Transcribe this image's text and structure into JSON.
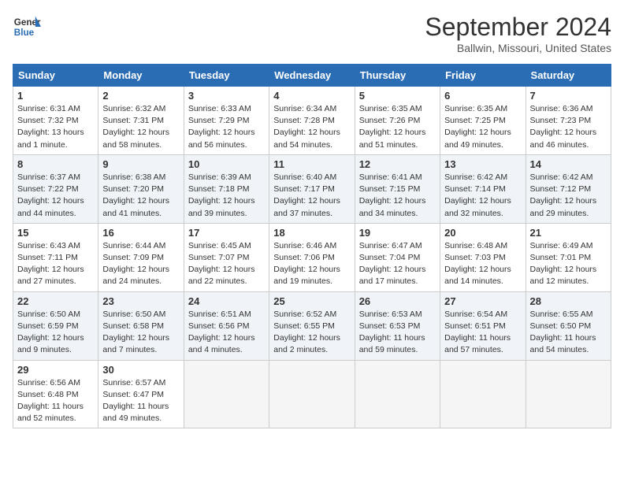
{
  "header": {
    "logo_line1": "General",
    "logo_line2": "Blue",
    "month_title": "September 2024",
    "location": "Ballwin, Missouri, United States"
  },
  "days_of_week": [
    "Sunday",
    "Monday",
    "Tuesday",
    "Wednesday",
    "Thursday",
    "Friday",
    "Saturday"
  ],
  "weeks": [
    [
      {
        "day": "1",
        "info": "Sunrise: 6:31 AM\nSunset: 7:32 PM\nDaylight: 13 hours\nand 1 minute."
      },
      {
        "day": "2",
        "info": "Sunrise: 6:32 AM\nSunset: 7:31 PM\nDaylight: 12 hours\nand 58 minutes."
      },
      {
        "day": "3",
        "info": "Sunrise: 6:33 AM\nSunset: 7:29 PM\nDaylight: 12 hours\nand 56 minutes."
      },
      {
        "day": "4",
        "info": "Sunrise: 6:34 AM\nSunset: 7:28 PM\nDaylight: 12 hours\nand 54 minutes."
      },
      {
        "day": "5",
        "info": "Sunrise: 6:35 AM\nSunset: 7:26 PM\nDaylight: 12 hours\nand 51 minutes."
      },
      {
        "day": "6",
        "info": "Sunrise: 6:35 AM\nSunset: 7:25 PM\nDaylight: 12 hours\nand 49 minutes."
      },
      {
        "day": "7",
        "info": "Sunrise: 6:36 AM\nSunset: 7:23 PM\nDaylight: 12 hours\nand 46 minutes."
      }
    ],
    [
      {
        "day": "8",
        "info": "Sunrise: 6:37 AM\nSunset: 7:22 PM\nDaylight: 12 hours\nand 44 minutes."
      },
      {
        "day": "9",
        "info": "Sunrise: 6:38 AM\nSunset: 7:20 PM\nDaylight: 12 hours\nand 41 minutes."
      },
      {
        "day": "10",
        "info": "Sunrise: 6:39 AM\nSunset: 7:18 PM\nDaylight: 12 hours\nand 39 minutes."
      },
      {
        "day": "11",
        "info": "Sunrise: 6:40 AM\nSunset: 7:17 PM\nDaylight: 12 hours\nand 37 minutes."
      },
      {
        "day": "12",
        "info": "Sunrise: 6:41 AM\nSunset: 7:15 PM\nDaylight: 12 hours\nand 34 minutes."
      },
      {
        "day": "13",
        "info": "Sunrise: 6:42 AM\nSunset: 7:14 PM\nDaylight: 12 hours\nand 32 minutes."
      },
      {
        "day": "14",
        "info": "Sunrise: 6:42 AM\nSunset: 7:12 PM\nDaylight: 12 hours\nand 29 minutes."
      }
    ],
    [
      {
        "day": "15",
        "info": "Sunrise: 6:43 AM\nSunset: 7:11 PM\nDaylight: 12 hours\nand 27 minutes."
      },
      {
        "day": "16",
        "info": "Sunrise: 6:44 AM\nSunset: 7:09 PM\nDaylight: 12 hours\nand 24 minutes."
      },
      {
        "day": "17",
        "info": "Sunrise: 6:45 AM\nSunset: 7:07 PM\nDaylight: 12 hours\nand 22 minutes."
      },
      {
        "day": "18",
        "info": "Sunrise: 6:46 AM\nSunset: 7:06 PM\nDaylight: 12 hours\nand 19 minutes."
      },
      {
        "day": "19",
        "info": "Sunrise: 6:47 AM\nSunset: 7:04 PM\nDaylight: 12 hours\nand 17 minutes."
      },
      {
        "day": "20",
        "info": "Sunrise: 6:48 AM\nSunset: 7:03 PM\nDaylight: 12 hours\nand 14 minutes."
      },
      {
        "day": "21",
        "info": "Sunrise: 6:49 AM\nSunset: 7:01 PM\nDaylight: 12 hours\nand 12 minutes."
      }
    ],
    [
      {
        "day": "22",
        "info": "Sunrise: 6:50 AM\nSunset: 6:59 PM\nDaylight: 12 hours\nand 9 minutes."
      },
      {
        "day": "23",
        "info": "Sunrise: 6:50 AM\nSunset: 6:58 PM\nDaylight: 12 hours\nand 7 minutes."
      },
      {
        "day": "24",
        "info": "Sunrise: 6:51 AM\nSunset: 6:56 PM\nDaylight: 12 hours\nand 4 minutes."
      },
      {
        "day": "25",
        "info": "Sunrise: 6:52 AM\nSunset: 6:55 PM\nDaylight: 12 hours\nand 2 minutes."
      },
      {
        "day": "26",
        "info": "Sunrise: 6:53 AM\nSunset: 6:53 PM\nDaylight: 11 hours\nand 59 minutes."
      },
      {
        "day": "27",
        "info": "Sunrise: 6:54 AM\nSunset: 6:51 PM\nDaylight: 11 hours\nand 57 minutes."
      },
      {
        "day": "28",
        "info": "Sunrise: 6:55 AM\nSunset: 6:50 PM\nDaylight: 11 hours\nand 54 minutes."
      }
    ],
    [
      {
        "day": "29",
        "info": "Sunrise: 6:56 AM\nSunset: 6:48 PM\nDaylight: 11 hours\nand 52 minutes."
      },
      {
        "day": "30",
        "info": "Sunrise: 6:57 AM\nSunset: 6:47 PM\nDaylight: 11 hours\nand 49 minutes."
      },
      {
        "day": "",
        "info": ""
      },
      {
        "day": "",
        "info": ""
      },
      {
        "day": "",
        "info": ""
      },
      {
        "day": "",
        "info": ""
      },
      {
        "day": "",
        "info": ""
      }
    ]
  ]
}
